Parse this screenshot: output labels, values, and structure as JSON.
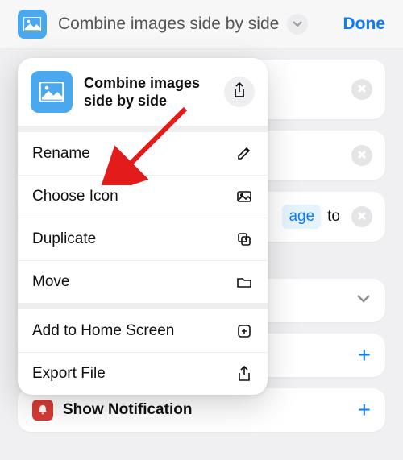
{
  "header": {
    "title": "Combine images side by side",
    "done_label": "Done"
  },
  "menu": {
    "title": "Combine images side by side",
    "rows": {
      "rename": "Rename",
      "choose_icon": "Choose Icon",
      "duplicate": "Duplicate",
      "move": "Move",
      "add_home": "Add to Home Screen",
      "export_file": "Export File"
    }
  },
  "background": {
    "token": "age",
    "to_text": "to",
    "show_notification": "Show Notification"
  }
}
